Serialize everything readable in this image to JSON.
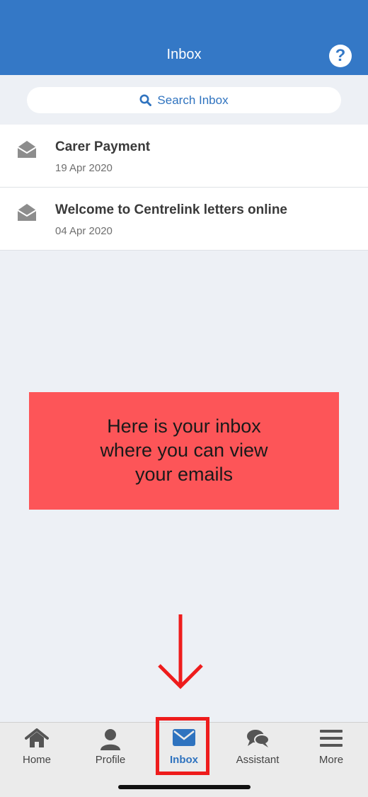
{
  "header": {
    "title": "Inbox",
    "help_label": "?"
  },
  "search": {
    "placeholder": "Search Inbox"
  },
  "messages": [
    {
      "subject": "Carer Payment",
      "date": "19 Apr 2020"
    },
    {
      "subject": "Welcome to Centrelink letters online",
      "date": "04 Apr 2020"
    }
  ],
  "callout": {
    "text": "Here is your inbox where you can view your emails"
  },
  "tabs": [
    {
      "label": "Home",
      "icon": "home-icon"
    },
    {
      "label": "Profile",
      "icon": "person-icon"
    },
    {
      "label": "Inbox",
      "icon": "envelope-icon",
      "active": true
    },
    {
      "label": "Assistant",
      "icon": "chat-bubbles-icon"
    },
    {
      "label": "More",
      "icon": "menu-icon"
    }
  ],
  "colors": {
    "header": "#3478c6",
    "accent": "#2f73bf",
    "callout": "#fd5558",
    "annotation_red": "#ee1c1c",
    "background": "#edf0f5"
  }
}
